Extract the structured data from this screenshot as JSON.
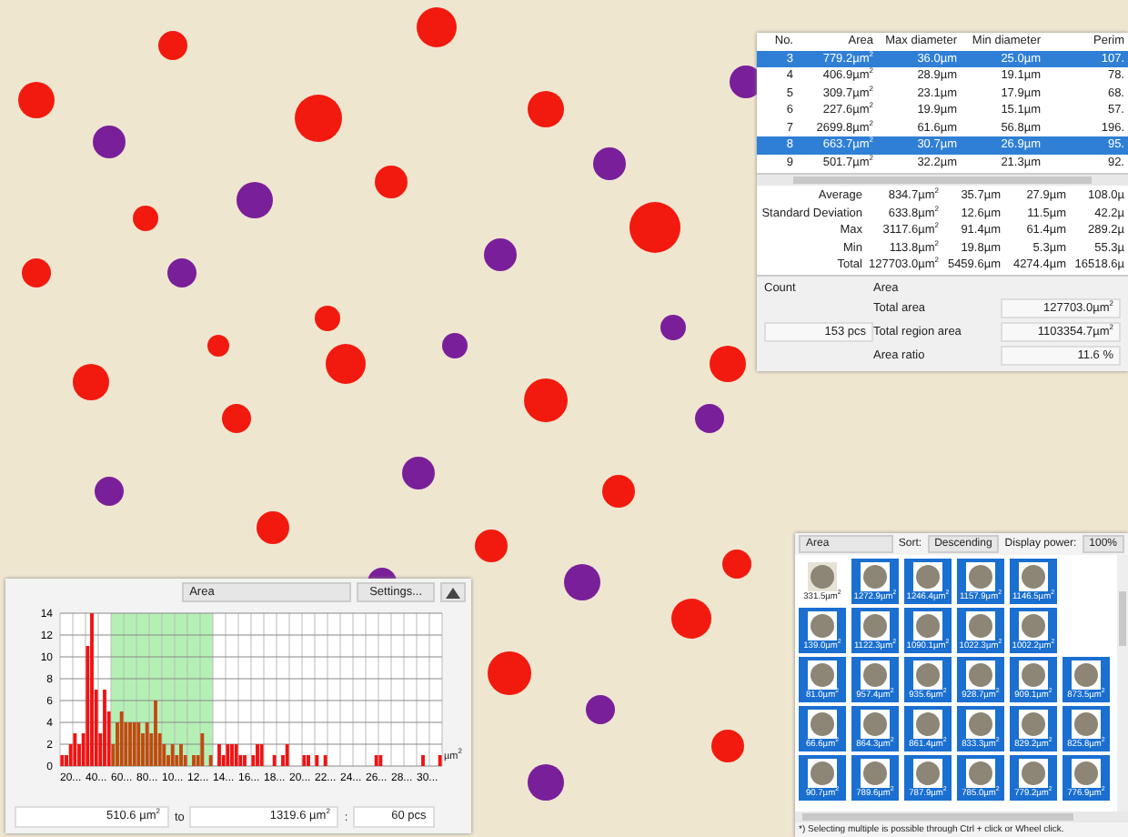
{
  "results_table": {
    "columns": [
      "No.",
      "Area",
      "Max diameter",
      "Min diameter",
      "Perim"
    ],
    "rows": [
      {
        "cells": [
          "3",
          "779.2µm$^{2}$",
          "36.0µm",
          "25.0µm",
          "107."
        ],
        "selected": true
      },
      {
        "cells": [
          "4",
          "406.9µm$^{2}$",
          "28.9µm",
          "19.1µm",
          "78."
        ],
        "selected": false
      },
      {
        "cells": [
          "5",
          "309.7µm$^{2}$",
          "23.1µm",
          "17.9µm",
          "68."
        ],
        "selected": false
      },
      {
        "cells": [
          "6",
          "227.6µm$^{2}$",
          "19.9µm",
          "15.1µm",
          "57."
        ],
        "selected": false
      },
      {
        "cells": [
          "7",
          "2699.8µm$^{2}$",
          "61.6µm",
          "56.8µm",
          "196."
        ],
        "selected": false
      },
      {
        "cells": [
          "8",
          "663.7µm$^{2}$",
          "30.7µm",
          "26.9µm",
          "95."
        ],
        "selected": true
      },
      {
        "cells": [
          "9",
          "501.7µm$^{2}$",
          "32.2µm",
          "21.3µm",
          "92."
        ],
        "selected": false
      }
    ],
    "stats": [
      {
        "cells": [
          "Average",
          "834.7µm$^{2}$",
          "35.7µm",
          "27.9µm",
          "108.0µ"
        ]
      },
      {
        "cells": [
          "Standard Deviation",
          "633.8µm$^{2}$",
          "12.6µm",
          "11.5µm",
          "42.2µ"
        ]
      },
      {
        "cells": [
          "Max",
          "3117.6µm$^{2}$",
          "91.4µm",
          "61.4µm",
          "289.2µ"
        ]
      },
      {
        "cells": [
          "Min",
          "113.8µm$^{2}$",
          "19.8µm",
          "5.3µm",
          "55.3µ"
        ]
      },
      {
        "cells": [
          "Total",
          "127703.0µm$^{2}$",
          "5459.6µm",
          "4274.4µm",
          "16518.6µ"
        ]
      }
    ]
  },
  "summary": {
    "count_label": "Count",
    "count_value": "153 pcs",
    "area_label": "Area",
    "fields": [
      {
        "label": "Total area",
        "value": "127703.0µm$^{2}$"
      },
      {
        "label": "Total region area",
        "value": "1103354.7µm$^{2}$"
      },
      {
        "label": "Area ratio",
        "value": "11.6  %"
      }
    ]
  },
  "histogram": {
    "field": "Area",
    "settings_button": "Settings...",
    "chart_data": {
      "type": "bar",
      "xlabel": "µm$^{2}$",
      "grid": true,
      "ylim": [
        0,
        14
      ],
      "yticks": [
        0,
        2,
        4,
        6,
        8,
        10,
        12,
        14
      ],
      "categories": [
        null,
        null,
        "20...",
        null,
        null,
        null,
        null,
        null,
        "40...",
        null,
        null,
        null,
        null,
        null,
        "60...",
        null,
        null,
        null,
        null,
        null,
        "80...",
        null,
        null,
        null,
        null,
        null,
        "10...",
        null,
        null,
        null,
        null,
        null,
        "12...",
        null,
        null,
        null,
        null,
        null,
        "14...",
        null,
        null,
        null,
        null,
        null,
        "16...",
        null,
        null,
        null,
        null,
        null,
        "18...",
        null,
        null,
        null,
        null,
        null,
        "20...",
        null,
        null,
        null,
        null,
        null,
        "22...",
        null,
        null,
        null,
        null,
        null,
        "24...",
        null,
        null,
        null,
        null,
        null,
        "26...",
        null,
        null,
        null,
        null,
        null,
        "28...",
        null,
        null,
        null,
        null,
        null,
        "30...",
        null,
        null,
        null
      ],
      "series": [
        {
          "color": "#f01212",
          "values": [
            1,
            1,
            2,
            3,
            2,
            3,
            11,
            14,
            7,
            3,
            7,
            5,
            null,
            null,
            null,
            null,
            null,
            null,
            null,
            null,
            null,
            null,
            null,
            null,
            null,
            null,
            null,
            null,
            null,
            null,
            null,
            null,
            null,
            null,
            null,
            null,
            0,
            2,
            1,
            2,
            2,
            2,
            1,
            1,
            0,
            1,
            2,
            2,
            0,
            0,
            1,
            0,
            1,
            2,
            0,
            0,
            0,
            1,
            1,
            0,
            1,
            0,
            1,
            0,
            0,
            0,
            0,
            0,
            0,
            0,
            0,
            0,
            0,
            0,
            1,
            1,
            0,
            0,
            0,
            0,
            0,
            0,
            0,
            0,
            0,
            1,
            0,
            0,
            0,
            1
          ]
        },
        {
          "color": "#c04a10",
          "values": [
            null,
            null,
            null,
            null,
            null,
            null,
            null,
            null,
            null,
            null,
            null,
            null,
            2,
            4,
            5,
            4,
            4,
            4,
            4,
            3,
            4,
            3,
            6,
            3,
            2,
            1,
            2,
            1,
            2,
            1,
            0,
            1,
            1,
            3,
            0,
            1,
            null,
            null,
            null,
            null,
            null,
            null,
            null,
            null,
            null,
            null,
            null,
            null,
            null,
            null,
            null,
            null,
            null,
            null,
            null,
            null,
            null,
            null,
            null,
            null,
            null,
            null,
            null,
            null,
            null,
            null,
            null,
            null,
            null,
            null,
            null,
            null,
            null,
            null,
            null,
            null,
            null,
            null,
            null,
            null,
            null,
            null,
            null,
            null,
            null,
            null,
            null,
            null,
            null,
            null
          ]
        }
      ]
    },
    "range_from": "510.6 µm$^{2}$",
    "range_to_label": "to",
    "range_to": "1319.6 µm$^{2}$",
    "separator": ":",
    "count": "60 pcs"
  },
  "gallery": {
    "field": "Area",
    "sort_label": "Sort:",
    "sort": "Descending",
    "power_label": "Display power:",
    "power": "100%",
    "rows": [
      [
        {
          "label": "331.5µm$^{2}$",
          "selected": false
        },
        {
          "label": "1272.9µm$^{2}$",
          "selected": true
        },
        {
          "label": "1246.4µm$^{2}$",
          "selected": true
        },
        {
          "label": "1157.9µm$^{2}$",
          "selected": true
        },
        {
          "label": "1146.5µm$^{2}$",
          "selected": true
        }
      ],
      [
        {
          "label": "139.0µm$^{2}$",
          "selected": true
        },
        {
          "label": "1122.3µm$^{2}$",
          "selected": true
        },
        {
          "label": "1090.1µm$^{2}$",
          "selected": true
        },
        {
          "label": "1022.3µm$^{2}$",
          "selected": true
        },
        {
          "label": "1002.2µm$^{2}$",
          "selected": true
        }
      ],
      [
        {
          "label": "81.0µm$^{2}$",
          "selected": true
        },
        {
          "label": "957.4µm$^{2}$",
          "selected": true
        },
        {
          "label": "935.6µm$^{2}$",
          "selected": true
        },
        {
          "label": "928.7µm$^{2}$",
          "selected": true
        },
        {
          "label": "909.1µm$^{2}$",
          "selected": true
        },
        {
          "label": "873.5µm$^{2}$",
          "selected": true
        }
      ],
      [
        {
          "label": "66.6µm$^{2}$",
          "selected": true
        },
        {
          "label": "864.3µm$^{2}$",
          "selected": true
        },
        {
          "label": "861.4µm$^{2}$",
          "selected": true
        },
        {
          "label": "833.3µm$^{2}$",
          "selected": true
        },
        {
          "label": "829.2µm$^{2}$",
          "selected": true
        },
        {
          "label": "825.8µm$^{2}$",
          "selected": true
        }
      ],
      [
        {
          "label": "90.7µm$^{2}$",
          "selected": true
        },
        {
          "label": "789.6µm$^{2}$",
          "selected": true
        },
        {
          "label": "787.9µm$^{2}$",
          "selected": true
        },
        {
          "label": "785.0µm$^{2}$",
          "selected": true
        },
        {
          "label": "779.2µm$^{2}$",
          "selected": true
        },
        {
          "label": "776.9µm$^{2}$",
          "selected": true
        }
      ]
    ],
    "note": "*) Selecting multiple is possible through Ctrl + click or Wheel click."
  }
}
